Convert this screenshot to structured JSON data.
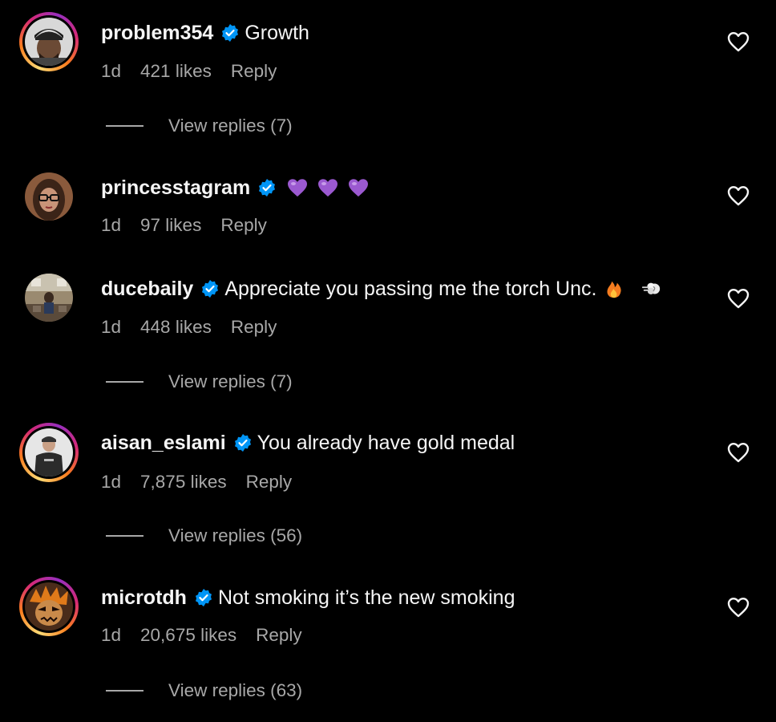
{
  "comments": [
    {
      "username": "problem354",
      "text": "Growth",
      "time": "1d",
      "likes": "421 likes",
      "reply": "Reply",
      "view_replies": "View replies (7)",
      "avatar_icon": "avatar-man-cap-icon"
    },
    {
      "username": "princesstagram",
      "text": "💜💜💜",
      "time": "1d",
      "likes": "97 likes",
      "reply": "Reply",
      "avatar_icon": "avatar-woman-glasses-icon"
    },
    {
      "username": "ducebaily",
      "text": "Appreciate you passing me the torch Unc.",
      "time": "1d",
      "likes": "448 likes",
      "reply": "Reply",
      "view_replies": "View replies (7)",
      "avatar_icon": "avatar-room-icon"
    },
    {
      "username": "aisan_eslami",
      "text": "You already have gold medal",
      "time": "1d",
      "likes": "7,875 likes",
      "reply": "Reply",
      "view_replies": "View replies (56)",
      "avatar_icon": "avatar-person-hoodie-icon"
    },
    {
      "username": "microtdh",
      "text": "Not smoking it’s the new smoking",
      "time": "1d",
      "likes": "20,675 likes",
      "reply": "Reply",
      "view_replies": "View replies (63)",
      "avatar_icon": "avatar-anime-character-icon"
    }
  ],
  "colors": {
    "background": "#000000",
    "primary_text": "#f5f5f5",
    "secondary_text": "#a8a8a8",
    "verified": "#0095f6"
  }
}
